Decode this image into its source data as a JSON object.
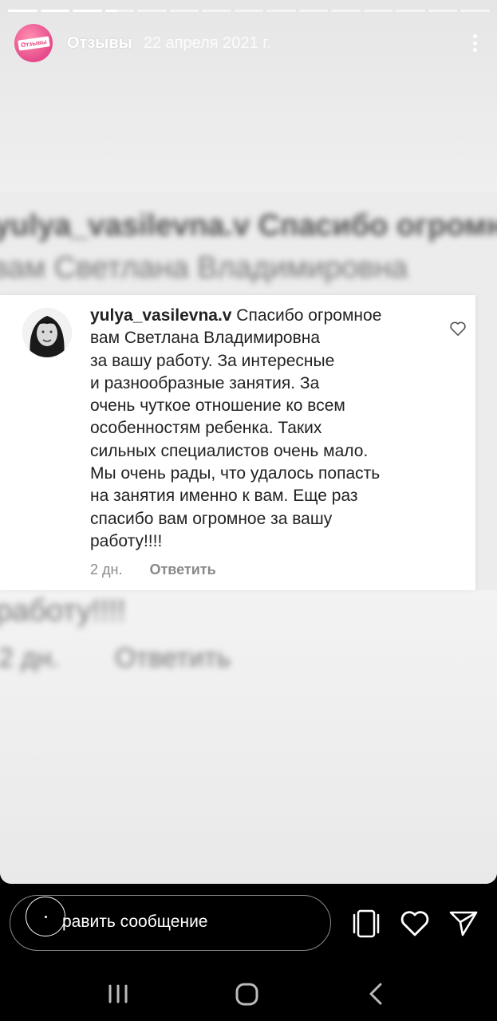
{
  "story": {
    "account": "Отзывы",
    "date": "22 апреля 2021 г.",
    "avatar_badge": "Отзывы",
    "progress": {
      "segments": 15,
      "completed": 3,
      "current_fraction": 0.3
    }
  },
  "background_blur": {
    "line1": "yulya_vasilevna.v Спасибо огромное",
    "line2": "вам  Светлана Владимировна",
    "line3": "работу!!!!",
    "line4_time": "2 дн.",
    "line4_reply": "Ответить"
  },
  "comment": {
    "username": "yulya_vasilevna.v",
    "text": " Спасибо огромное\nвам  Светлана Владимировна\nза вашу  работу. За интересные\nи разнообразные  занятия. За\nочень чуткое отношение ко всем\nособенностям ребенка. Таких\nсильных специалистов очень мало.\nМы очень рады, что удалось попасть\nна занятия именно к вам. Еще раз\nспасибо вам огромное за вашу\nработу!!!!",
    "time": "2 дн.",
    "reply_label": "Ответить"
  },
  "bottom_bar": {
    "message_text": "равить сообщение"
  },
  "icons": {
    "more": "more-vertical-icon",
    "like": "heart-icon",
    "share": "send-icon",
    "devices": "devices-icon",
    "nav_recents": "recents-icon",
    "nav_home": "home-icon",
    "nav_back": "back-icon"
  }
}
